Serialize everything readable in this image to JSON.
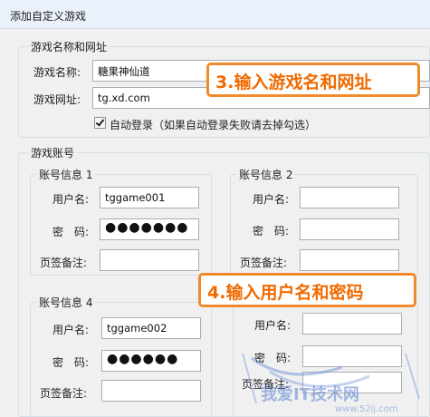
{
  "window": {
    "title": "添加自定义游戏"
  },
  "game_info": {
    "group_title": "游戏名称和网址",
    "name_label": "游戏名称:",
    "name_value": "糖果神仙道",
    "url_label": "游戏网址:",
    "url_value": "tg.xd.com",
    "auto_login_checked": true,
    "auto_login_label": "自动登录（如果自动登录失败请去掉勾选）"
  },
  "accounts": {
    "group_title": "游戏账号",
    "username_label": "用户名:",
    "password_label": "密　码:",
    "note_label": "页签备注:",
    "items": [
      {
        "title": "账号信息 1",
        "username": "tggame001",
        "password": "●●●●●●●",
        "note": ""
      },
      {
        "title": "账号信息 2",
        "username": "",
        "password": "",
        "note": ""
      },
      {
        "title": "账号信息 4",
        "username": "tggame002",
        "password": "●●●●●●",
        "note": ""
      },
      {
        "title": "",
        "username": "",
        "password": "",
        "note": ""
      }
    ]
  },
  "callouts": {
    "step3": "3.输入游戏名和网址",
    "step4": "4.输入用户名和密码"
  },
  "watermark": {
    "text": "我爱IT技术网",
    "url": "www.52ij.com"
  }
}
